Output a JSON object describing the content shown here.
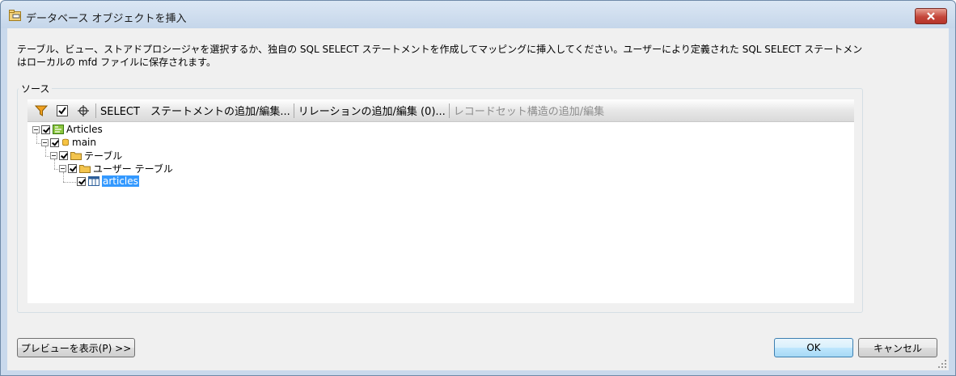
{
  "window": {
    "title": "データベース オブジェクトを挿入"
  },
  "description": {
    "line1": "テーブル、ビュー、ストアドプロシージャを選択するか、独自の SQL SELECT ステートメントを作成してマッピングに挿入してください。ユーザーにより定義された SQL SELECT ステートメン",
    "line2": "はローカルの mfd ファイルに保存されます。"
  },
  "source_group": {
    "label": "ソース"
  },
  "toolbar": {
    "icons": [
      "filter-icon",
      "checkbox-icon",
      "locate-icon"
    ],
    "select_statement": "SELECT　ステートメントの追加/編集...",
    "relations": "リレーションの追加/編集 (0)...",
    "recordset": "レコードセット構造の追加/編集"
  },
  "tree": {
    "root": {
      "label": "Articles",
      "checked": true,
      "icon": "database-connection-icon"
    },
    "database": {
      "label": "main",
      "checked": true,
      "icon": "database-icon"
    },
    "tables_folder": {
      "label": "テーブル",
      "checked": true,
      "icon": "folder-icon"
    },
    "user_tables_folder": {
      "label": "ユーザー テーブル",
      "checked": true,
      "icon": "folder-icon"
    },
    "table": {
      "label": "articles",
      "checked": true,
      "selected": true,
      "icon": "table-icon"
    }
  },
  "buttons": {
    "preview": "プレビューを表示(P) >>",
    "ok": "OK",
    "cancel": "キャンセル"
  },
  "colors": {
    "selection": "#3399ff",
    "close_button": "#c4463a",
    "titlebar": "#c5d6ea"
  }
}
